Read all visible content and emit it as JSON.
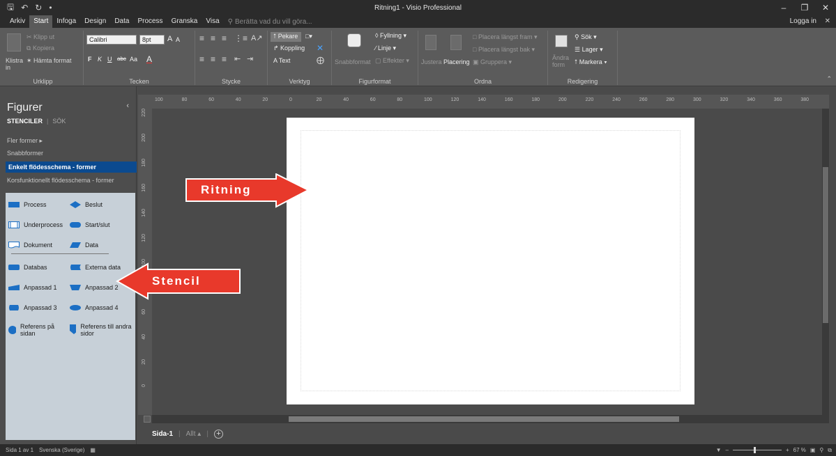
{
  "window": {
    "title": "Ritning1 - Visio Professional",
    "qat_icons": [
      "save-icon",
      "undo-icon",
      "redo-icon",
      "customize-icon"
    ],
    "controls": [
      "minimize-icon",
      "restore-icon",
      "close-icon"
    ]
  },
  "tabs": {
    "items": [
      "Arkiv",
      "Start",
      "Infoga",
      "Design",
      "Data",
      "Process",
      "Granska",
      "Visa"
    ],
    "active": "Start",
    "tellme": "Berätta vad du vill göra...",
    "login": "Logga in"
  },
  "ribbon": {
    "clipboard": {
      "label": "Urklipp",
      "paste": "Klistra in",
      "cut": "Klipp ut",
      "copy": "Kopiera",
      "format_painter": "Hämta format"
    },
    "font": {
      "label": "Tecken",
      "family": "Calibri",
      "size": "8pt",
      "grow": "A",
      "shrink": "A",
      "bold": "F",
      "italic": "K",
      "underline": "U",
      "strike": "abc",
      "case": "Aa",
      "color": "A"
    },
    "paragraph": {
      "label": "Stycke"
    },
    "tools": {
      "label": "Verktyg",
      "pointer": "Pekare",
      "connector": "Koppling",
      "text": "Text"
    },
    "shape_styles": {
      "label": "Figurformat",
      "quick_styles": "Snabbformat",
      "fill": "Fyllning",
      "line": "Linje",
      "effects": "Effekter"
    },
    "arrange": {
      "label": "Ordna",
      "align": "Justera",
      "position": "Placering",
      "bring_front": "Placera längst fram",
      "send_back": "Placera längst bak",
      "group": "Gruppera"
    },
    "editing": {
      "label": "Redigering",
      "change_shape": "Ändra form",
      "find": "Sök",
      "layers": "Lager",
      "select": "Markera"
    }
  },
  "shapes_panel": {
    "title": "Figurer",
    "tab_stencils": "STENCILER",
    "tab_search": "SÖK",
    "more_shapes": "Fler former",
    "quick_shapes": "Snabbformer",
    "selected_stencil": "Enkelt flödesschema - former",
    "other_stencil": "Korsfunktionellt flödesschema - former",
    "shapes": [
      {
        "label": "Process",
        "icon": "process-shape-icon"
      },
      {
        "label": "Beslut",
        "icon": "decision-shape-icon"
      },
      {
        "label": "Underprocess",
        "icon": "subprocess-shape-icon"
      },
      {
        "label": "Start/slut",
        "icon": "start-end-shape-icon"
      },
      {
        "label": "Dokument",
        "icon": "document-shape-icon"
      },
      {
        "label": "Data",
        "icon": "data-shape-icon"
      },
      {
        "label": "Databas",
        "icon": "database-shape-icon"
      },
      {
        "label": "Externa data",
        "icon": "external-data-shape-icon"
      },
      {
        "label": "Anpassad 1",
        "icon": "custom1-shape-icon"
      },
      {
        "label": "Anpassad 2",
        "icon": "custom2-shape-icon"
      },
      {
        "label": "Anpassad 3",
        "icon": "custom3-shape-icon"
      },
      {
        "label": "Anpassad 4",
        "icon": "custom4-shape-icon"
      },
      {
        "label": "Referens på sidan",
        "icon": "on-page-reference-icon"
      },
      {
        "label": "Referens till andra sidor",
        "icon": "off-page-reference-icon"
      }
    ]
  },
  "rulers": {
    "horizontal": [
      "100",
      "80",
      "60",
      "40",
      "20",
      "0",
      "20",
      "40",
      "60",
      "80",
      "100",
      "120",
      "140",
      "160",
      "180",
      "200",
      "220",
      "240",
      "260",
      "280",
      "300",
      "320",
      "340",
      "360",
      "380"
    ],
    "vertical": [
      "220",
      "200",
      "180",
      "160",
      "140",
      "120",
      "100",
      "80",
      "60",
      "40",
      "20",
      "0"
    ]
  },
  "callouts": {
    "drawing": "Ritning",
    "stencil": "Stencil",
    "color": "#e8392b"
  },
  "page_tabs": {
    "active": "Sida-1",
    "all": "Allt",
    "add": "+"
  },
  "status": {
    "page": "Sida 1 av 1",
    "language": "Svenska (Sverige)",
    "zoom": "67 %"
  },
  "colors": {
    "selected_stencil": "#0b4a8f",
    "stencil_bg": "#c7d0d8",
    "shape_blue": "#1c6fc4"
  }
}
